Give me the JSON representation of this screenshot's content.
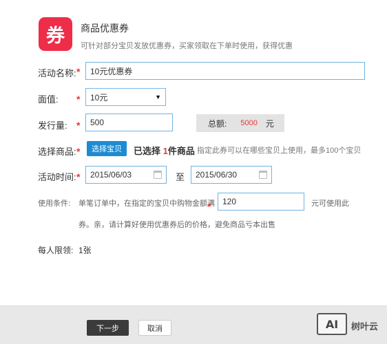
{
  "header": {
    "icon_char": "券",
    "title": "商品优惠券",
    "description": "可针对部分宝贝发放优惠券，买家领取在下单时使用，获得优惠"
  },
  "form": {
    "required_mark": "*",
    "activity_name": {
      "label": "活动名称:",
      "value": "10元优惠券"
    },
    "face_value": {
      "label": "面值:",
      "selected": "10元"
    },
    "quantity": {
      "label": "发行量:",
      "value": "500",
      "total_label": "总额:",
      "total_value": "5000",
      "total_unit": "元"
    },
    "products": {
      "label": "选择商品:",
      "button_label": "选择宝贝",
      "selected_prefix": "已选择",
      "selected_count": "1",
      "selected_suffix": "件商品",
      "hint": "指定此券可以在哪些宝贝上使用，最多100个宝贝"
    },
    "period": {
      "label": "活动时间:",
      "start": "2015/06/03",
      "separator": "至",
      "end": "2015/06/30"
    },
    "condition": {
      "label": "使用条件:",
      "text_before": "单笔订单中，在指定的宝贝中购物金额满",
      "amount": "120",
      "text_after": "元可使用此",
      "text_line2": "券。亲，请计算好使用优惠券后的价格，避免商品亏本出售"
    },
    "limit": {
      "label": "每人限领:",
      "value": "1张"
    }
  },
  "footer": {
    "next_label": "下一步",
    "cancel_label": "取消"
  },
  "watermark": {
    "logo_text": "AI",
    "brand": "树叶云"
  },
  "colors": {
    "icon_bg": "#ee2d49",
    "primary_button": "#1d8bd3",
    "required": "#e4393c",
    "input_border": "#6fb3e0",
    "highlight_count": "#e4393c",
    "total_value": "#e4393c"
  }
}
